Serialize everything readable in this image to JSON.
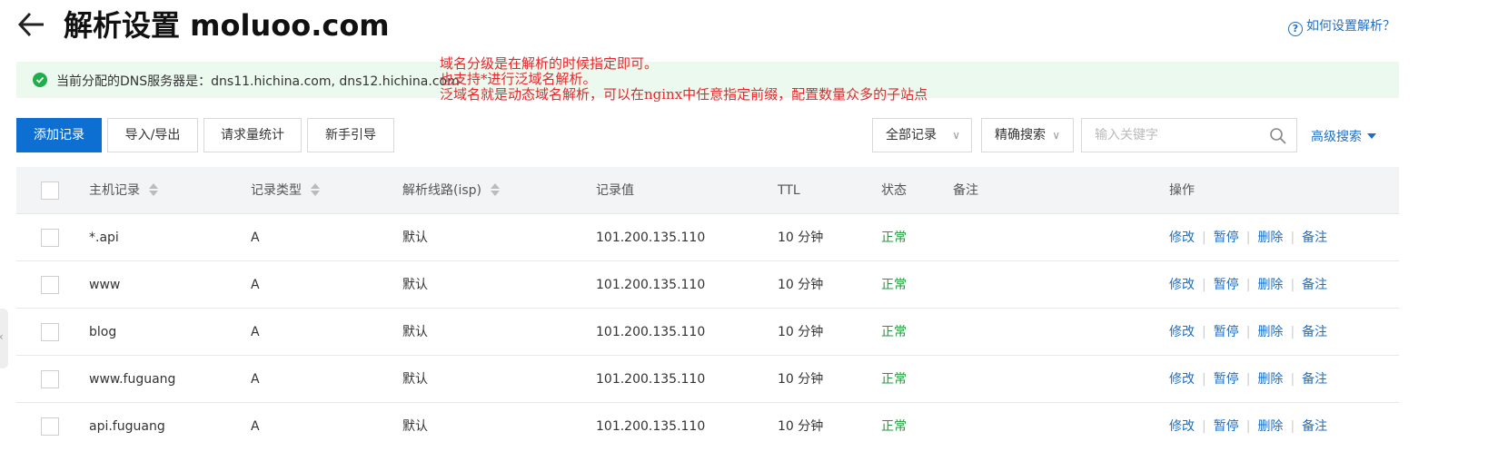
{
  "header": {
    "title": "解析设置 moluoo.com",
    "help_label": "如何设置解析？"
  },
  "notice": {
    "text": "当前分配的DNS服务器是：dns11.hichina.com, dns12.hichina.com"
  },
  "annotation": {
    "lines": [
      "域名分级是在解析的时候指定即可。",
      "也支持*进行泛域名解析。",
      "泛域名就是动态域名解析，可以在nginx中任意指定前缀，配置数量众多的子站点"
    ],
    "color": "#e8262c"
  },
  "toolbar": {
    "add_label": "添加记录",
    "import_export_label": "导入/导出",
    "stats_label": "请求量统计",
    "guide_label": "新手引导",
    "filter_all_label": "全部记录",
    "match_mode_label": "精确搜索",
    "search_placeholder": "输入关键字",
    "advanced_label": "高级搜索"
  },
  "table": {
    "headers": {
      "host": "主机记录",
      "type": "记录类型",
      "line": "解析线路(isp)",
      "value": "记录值",
      "ttl": "TTL",
      "status": "状态",
      "remark": "备注",
      "actions": "操作"
    },
    "rows": [
      {
        "host": "*.api",
        "type": "A",
        "line": "默认",
        "value": "101.200.135.110",
        "ttl": "10 分钟",
        "status": "正常",
        "remark": ""
      },
      {
        "host": "www",
        "type": "A",
        "line": "默认",
        "value": "101.200.135.110",
        "ttl": "10 分钟",
        "status": "正常",
        "remark": ""
      },
      {
        "host": "blog",
        "type": "A",
        "line": "默认",
        "value": "101.200.135.110",
        "ttl": "10 分钟",
        "status": "正常",
        "remark": ""
      },
      {
        "host": "www.fuguang",
        "type": "A",
        "line": "默认",
        "value": "101.200.135.110",
        "ttl": "10 分钟",
        "status": "正常",
        "remark": ""
      },
      {
        "host": "api.fuguang",
        "type": "A",
        "line": "默认",
        "value": "101.200.135.110",
        "ttl": "10 分钟",
        "status": "正常",
        "remark": ""
      }
    ],
    "actions": {
      "edit": "修改",
      "pause": "暂停",
      "delete": "删除",
      "remark": "备注",
      "separator": "|"
    }
  },
  "colors": {
    "primary": "#0d6fd1",
    "link": "#1f6fc5",
    "success": "#1f9d3c",
    "notice_bg": "#ecf9ee"
  }
}
